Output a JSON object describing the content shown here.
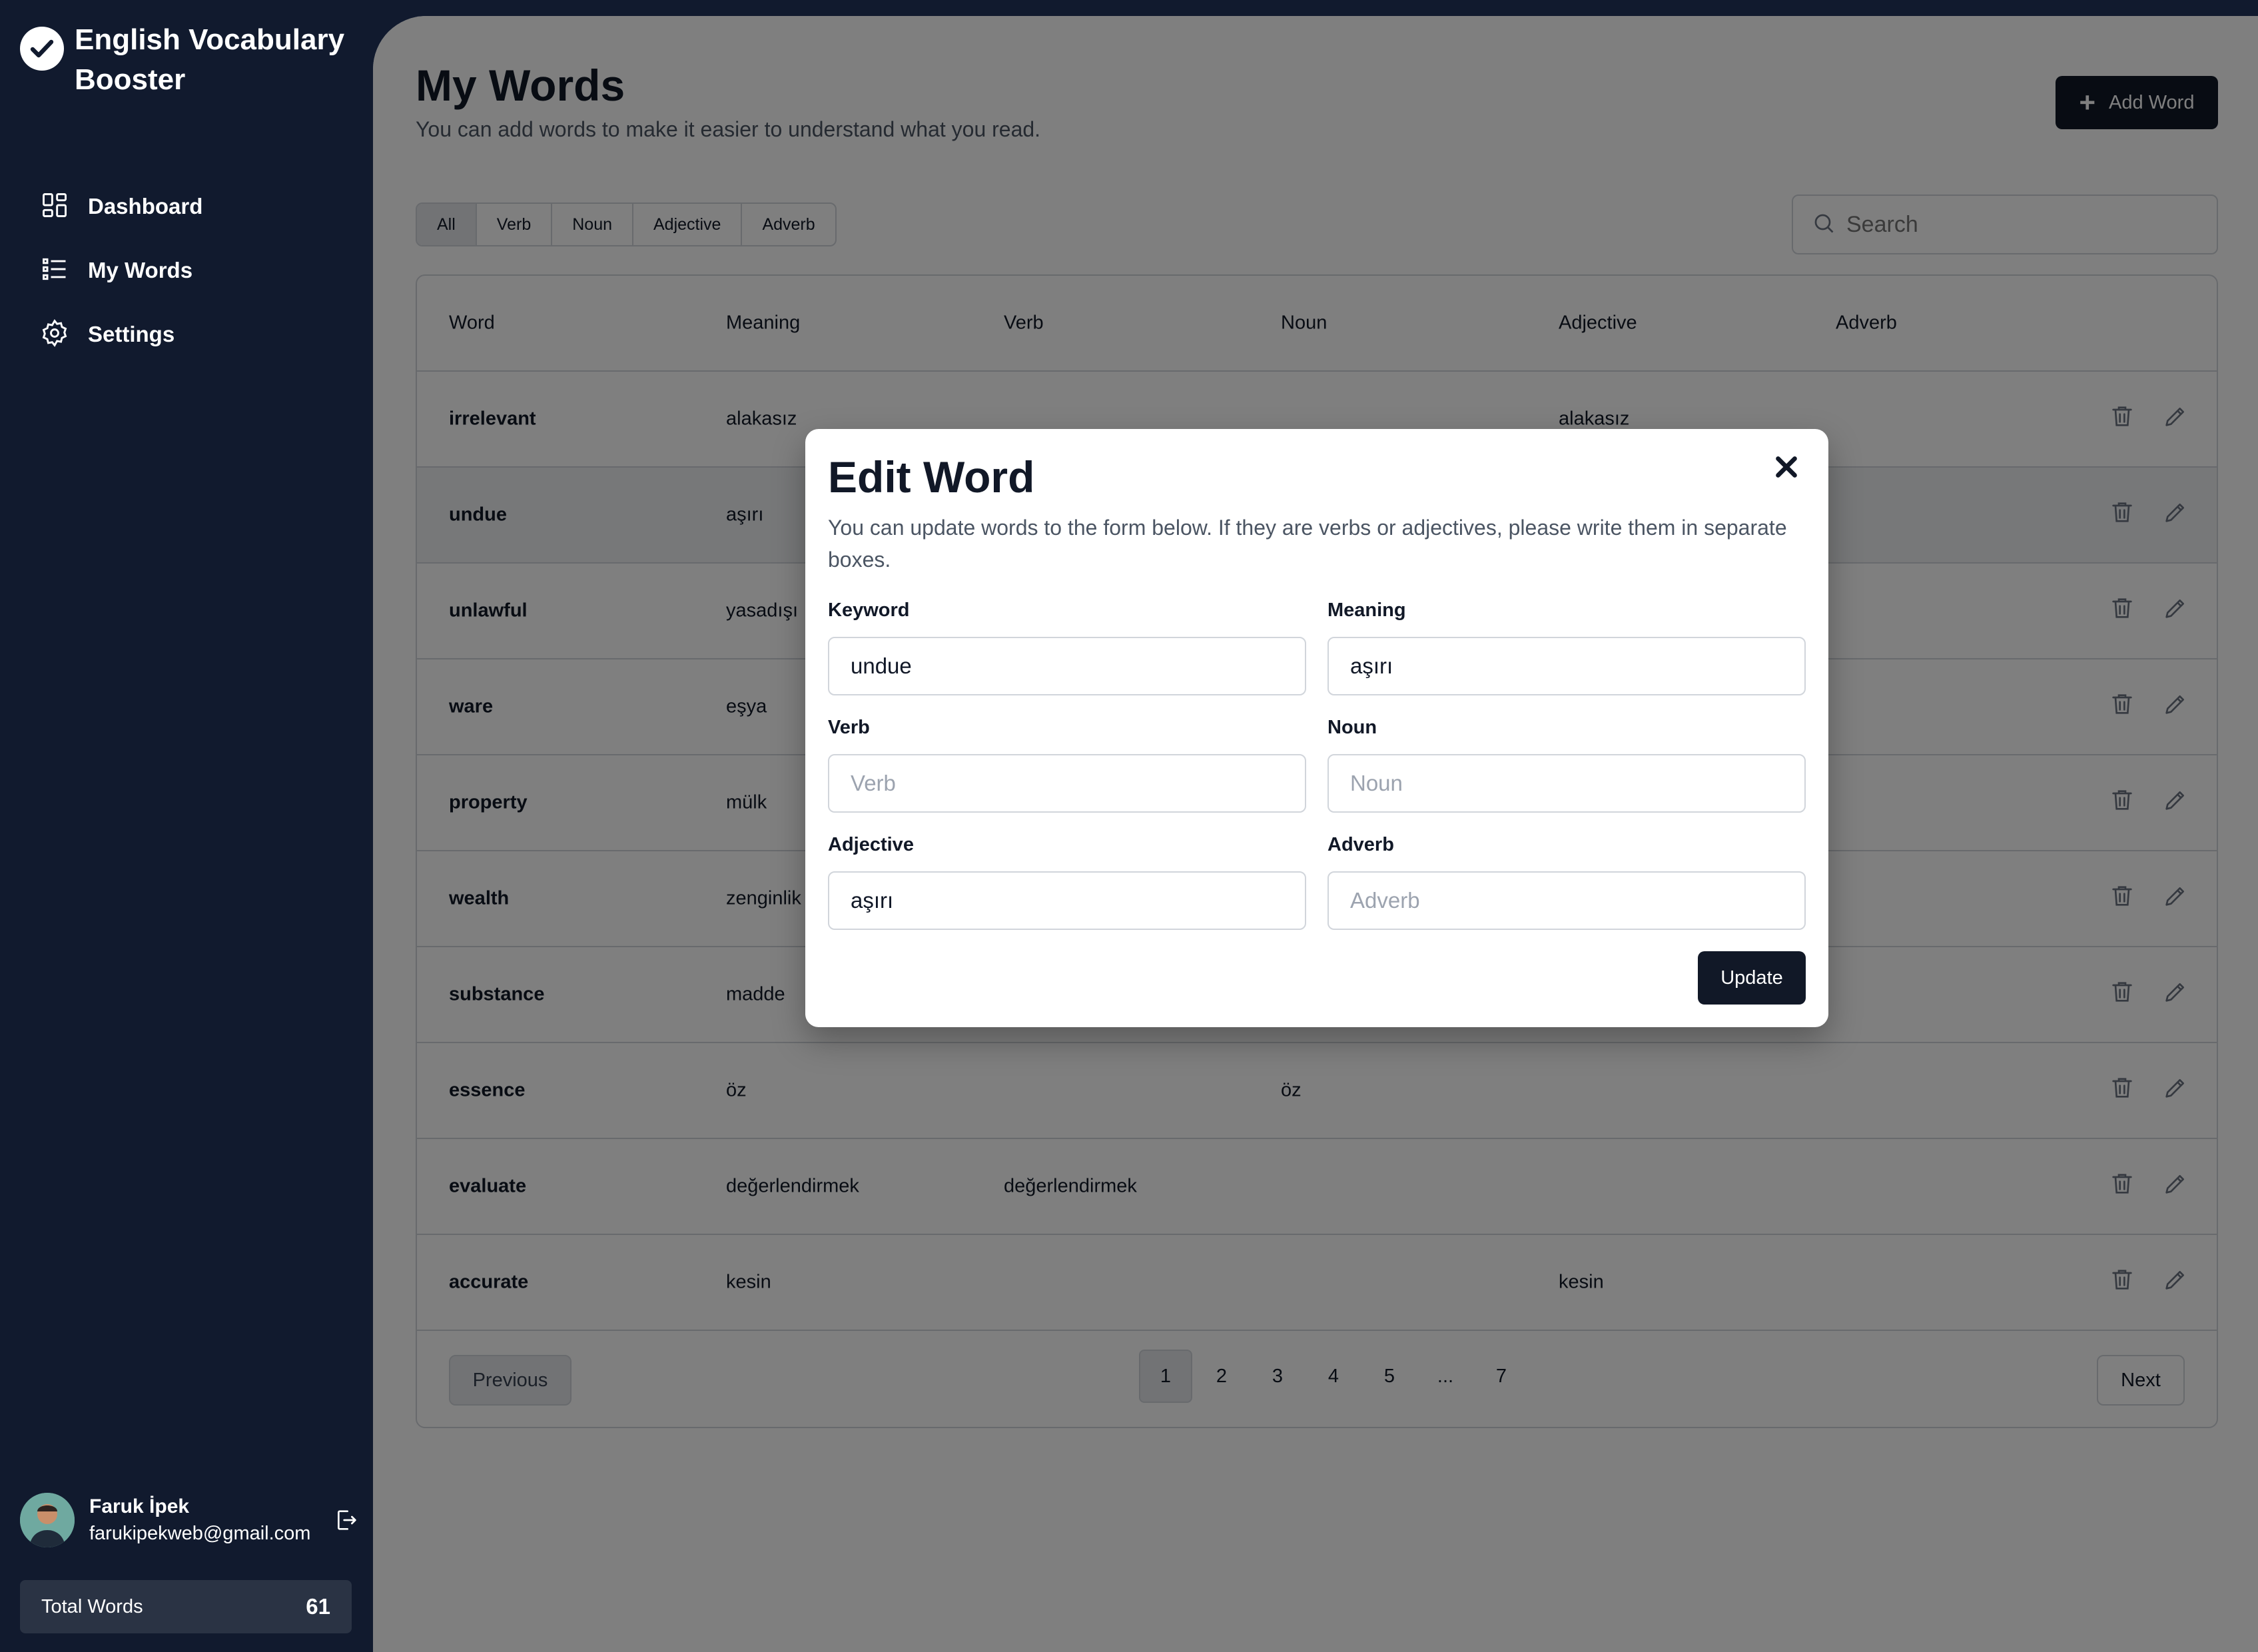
{
  "app": {
    "title": "English Vocabulary Booster"
  },
  "sidebar": {
    "items": [
      {
        "label": "Dashboard",
        "icon": "dashboard-icon"
      },
      {
        "label": "My Words",
        "icon": "list-icon"
      },
      {
        "label": "Settings",
        "icon": "gear-icon"
      }
    ]
  },
  "user": {
    "name": "Faruk İpek",
    "email": "farukipekweb@gmail.com"
  },
  "stats": {
    "total_label": "Total Words",
    "total_value": "61"
  },
  "header": {
    "title": "My Words",
    "subtitle": "You can add words to make it easier to understand what you read.",
    "add_label": "Add Word"
  },
  "filters": [
    "All",
    "Verb",
    "Noun",
    "Adjective",
    "Adverb"
  ],
  "active_filter": "All",
  "search": {
    "placeholder": "Search"
  },
  "table": {
    "columns": [
      "Word",
      "Meaning",
      "Verb",
      "Noun",
      "Adjective",
      "Adverb"
    ],
    "rows": [
      {
        "word": "irrelevant",
        "meaning": "alakasız",
        "verb": "",
        "noun": "",
        "adjective": "alakasız",
        "adverb": ""
      },
      {
        "word": "undue",
        "meaning": "aşırı",
        "verb": "",
        "noun": "",
        "adjective": "",
        "adverb": ""
      },
      {
        "word": "unlawful",
        "meaning": "yasadışı",
        "verb": "",
        "noun": "",
        "adjective": "",
        "adverb": ""
      },
      {
        "word": "ware",
        "meaning": "eşya",
        "verb": "",
        "noun": "",
        "adjective": "",
        "adverb": ""
      },
      {
        "word": "property",
        "meaning": "mülk",
        "verb": "",
        "noun": "",
        "adjective": "",
        "adverb": ""
      },
      {
        "word": "wealth",
        "meaning": "zenginlik",
        "verb": "",
        "noun": "",
        "adjective": "",
        "adverb": ""
      },
      {
        "word": "substance",
        "meaning": "madde",
        "verb": "",
        "noun": "",
        "adjective": "",
        "adverb": ""
      },
      {
        "word": "essence",
        "meaning": "öz",
        "verb": "",
        "noun": "öz",
        "adjective": "",
        "adverb": ""
      },
      {
        "word": "evaluate",
        "meaning": "değerlendirmek",
        "verb": "değerlendirmek",
        "noun": "",
        "adjective": "",
        "adverb": ""
      },
      {
        "word": "accurate",
        "meaning": "kesin",
        "verb": "",
        "noun": "",
        "adjective": "kesin",
        "adverb": ""
      }
    ]
  },
  "pagination": {
    "previous_label": "Previous",
    "next_label": "Next",
    "pages": [
      "1",
      "2",
      "3",
      "4",
      "5",
      "...",
      "7"
    ],
    "current": "1"
  },
  "modal": {
    "title": "Edit Word",
    "description": "You can update words to the form below. If they are verbs or adjectives, please write them in separate boxes.",
    "fields": {
      "keyword": {
        "label": "Keyword",
        "value": "undue",
        "placeholder": "Keyword"
      },
      "meaning": {
        "label": "Meaning",
        "value": "aşırı",
        "placeholder": "Meaning"
      },
      "verb": {
        "label": "Verb",
        "value": "",
        "placeholder": "Verb"
      },
      "noun": {
        "label": "Noun",
        "value": "",
        "placeholder": "Noun"
      },
      "adjective": {
        "label": "Adjective",
        "value": "aşırı",
        "placeholder": "Adjective"
      },
      "adverb": {
        "label": "Adverb",
        "value": "",
        "placeholder": "Adverb"
      }
    },
    "submit_label": "Update"
  },
  "colors": {
    "sidebar_bg": "#111a2e",
    "primary_button": "#111827",
    "overlay": "rgba(0,0,0,0.5)"
  }
}
